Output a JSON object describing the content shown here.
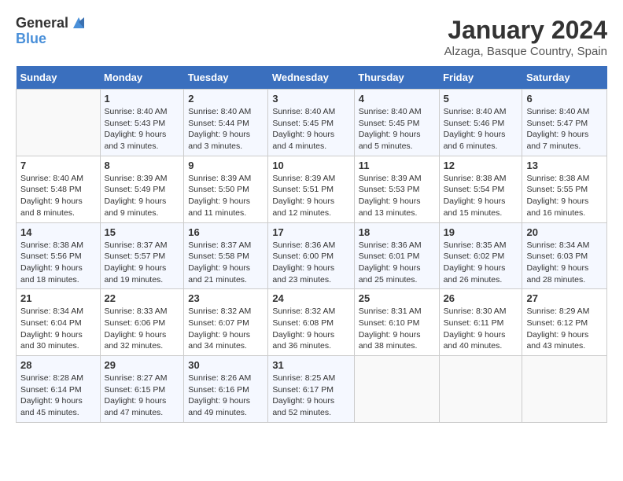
{
  "logo": {
    "general": "General",
    "blue": "Blue"
  },
  "title": "January 2024",
  "location": "Alzaga, Basque Country, Spain",
  "weekdays": [
    "Sunday",
    "Monday",
    "Tuesday",
    "Wednesday",
    "Thursday",
    "Friday",
    "Saturday"
  ],
  "weeks": [
    [
      {
        "day": "",
        "sunrise": "",
        "sunset": "",
        "daylight": ""
      },
      {
        "day": "1",
        "sunrise": "Sunrise: 8:40 AM",
        "sunset": "Sunset: 5:43 PM",
        "daylight": "Daylight: 9 hours and 3 minutes."
      },
      {
        "day": "2",
        "sunrise": "Sunrise: 8:40 AM",
        "sunset": "Sunset: 5:44 PM",
        "daylight": "Daylight: 9 hours and 3 minutes."
      },
      {
        "day": "3",
        "sunrise": "Sunrise: 8:40 AM",
        "sunset": "Sunset: 5:45 PM",
        "daylight": "Daylight: 9 hours and 4 minutes."
      },
      {
        "day": "4",
        "sunrise": "Sunrise: 8:40 AM",
        "sunset": "Sunset: 5:45 PM",
        "daylight": "Daylight: 9 hours and 5 minutes."
      },
      {
        "day": "5",
        "sunrise": "Sunrise: 8:40 AM",
        "sunset": "Sunset: 5:46 PM",
        "daylight": "Daylight: 9 hours and 6 minutes."
      },
      {
        "day": "6",
        "sunrise": "Sunrise: 8:40 AM",
        "sunset": "Sunset: 5:47 PM",
        "daylight": "Daylight: 9 hours and 7 minutes."
      }
    ],
    [
      {
        "day": "7",
        "sunrise": "Sunrise: 8:40 AM",
        "sunset": "Sunset: 5:48 PM",
        "daylight": "Daylight: 9 hours and 8 minutes."
      },
      {
        "day": "8",
        "sunrise": "Sunrise: 8:39 AM",
        "sunset": "Sunset: 5:49 PM",
        "daylight": "Daylight: 9 hours and 9 minutes."
      },
      {
        "day": "9",
        "sunrise": "Sunrise: 8:39 AM",
        "sunset": "Sunset: 5:50 PM",
        "daylight": "Daylight: 9 hours and 11 minutes."
      },
      {
        "day": "10",
        "sunrise": "Sunrise: 8:39 AM",
        "sunset": "Sunset: 5:51 PM",
        "daylight": "Daylight: 9 hours and 12 minutes."
      },
      {
        "day": "11",
        "sunrise": "Sunrise: 8:39 AM",
        "sunset": "Sunset: 5:53 PM",
        "daylight": "Daylight: 9 hours and 13 minutes."
      },
      {
        "day": "12",
        "sunrise": "Sunrise: 8:38 AM",
        "sunset": "Sunset: 5:54 PM",
        "daylight": "Daylight: 9 hours and 15 minutes."
      },
      {
        "day": "13",
        "sunrise": "Sunrise: 8:38 AM",
        "sunset": "Sunset: 5:55 PM",
        "daylight": "Daylight: 9 hours and 16 minutes."
      }
    ],
    [
      {
        "day": "14",
        "sunrise": "Sunrise: 8:38 AM",
        "sunset": "Sunset: 5:56 PM",
        "daylight": "Daylight: 9 hours and 18 minutes."
      },
      {
        "day": "15",
        "sunrise": "Sunrise: 8:37 AM",
        "sunset": "Sunset: 5:57 PM",
        "daylight": "Daylight: 9 hours and 19 minutes."
      },
      {
        "day": "16",
        "sunrise": "Sunrise: 8:37 AM",
        "sunset": "Sunset: 5:58 PM",
        "daylight": "Daylight: 9 hours and 21 minutes."
      },
      {
        "day": "17",
        "sunrise": "Sunrise: 8:36 AM",
        "sunset": "Sunset: 6:00 PM",
        "daylight": "Daylight: 9 hours and 23 minutes."
      },
      {
        "day": "18",
        "sunrise": "Sunrise: 8:36 AM",
        "sunset": "Sunset: 6:01 PM",
        "daylight": "Daylight: 9 hours and 25 minutes."
      },
      {
        "day": "19",
        "sunrise": "Sunrise: 8:35 AM",
        "sunset": "Sunset: 6:02 PM",
        "daylight": "Daylight: 9 hours and 26 minutes."
      },
      {
        "day": "20",
        "sunrise": "Sunrise: 8:34 AM",
        "sunset": "Sunset: 6:03 PM",
        "daylight": "Daylight: 9 hours and 28 minutes."
      }
    ],
    [
      {
        "day": "21",
        "sunrise": "Sunrise: 8:34 AM",
        "sunset": "Sunset: 6:04 PM",
        "daylight": "Daylight: 9 hours and 30 minutes."
      },
      {
        "day": "22",
        "sunrise": "Sunrise: 8:33 AM",
        "sunset": "Sunset: 6:06 PM",
        "daylight": "Daylight: 9 hours and 32 minutes."
      },
      {
        "day": "23",
        "sunrise": "Sunrise: 8:32 AM",
        "sunset": "Sunset: 6:07 PM",
        "daylight": "Daylight: 9 hours and 34 minutes."
      },
      {
        "day": "24",
        "sunrise": "Sunrise: 8:32 AM",
        "sunset": "Sunset: 6:08 PM",
        "daylight": "Daylight: 9 hours and 36 minutes."
      },
      {
        "day": "25",
        "sunrise": "Sunrise: 8:31 AM",
        "sunset": "Sunset: 6:10 PM",
        "daylight": "Daylight: 9 hours and 38 minutes."
      },
      {
        "day": "26",
        "sunrise": "Sunrise: 8:30 AM",
        "sunset": "Sunset: 6:11 PM",
        "daylight": "Daylight: 9 hours and 40 minutes."
      },
      {
        "day": "27",
        "sunrise": "Sunrise: 8:29 AM",
        "sunset": "Sunset: 6:12 PM",
        "daylight": "Daylight: 9 hours and 43 minutes."
      }
    ],
    [
      {
        "day": "28",
        "sunrise": "Sunrise: 8:28 AM",
        "sunset": "Sunset: 6:14 PM",
        "daylight": "Daylight: 9 hours and 45 minutes."
      },
      {
        "day": "29",
        "sunrise": "Sunrise: 8:27 AM",
        "sunset": "Sunset: 6:15 PM",
        "daylight": "Daylight: 9 hours and 47 minutes."
      },
      {
        "day": "30",
        "sunrise": "Sunrise: 8:26 AM",
        "sunset": "Sunset: 6:16 PM",
        "daylight": "Daylight: 9 hours and 49 minutes."
      },
      {
        "day": "31",
        "sunrise": "Sunrise: 8:25 AM",
        "sunset": "Sunset: 6:17 PM",
        "daylight": "Daylight: 9 hours and 52 minutes."
      },
      {
        "day": "",
        "sunrise": "",
        "sunset": "",
        "daylight": ""
      },
      {
        "day": "",
        "sunrise": "",
        "sunset": "",
        "daylight": ""
      },
      {
        "day": "",
        "sunrise": "",
        "sunset": "",
        "daylight": ""
      }
    ]
  ]
}
